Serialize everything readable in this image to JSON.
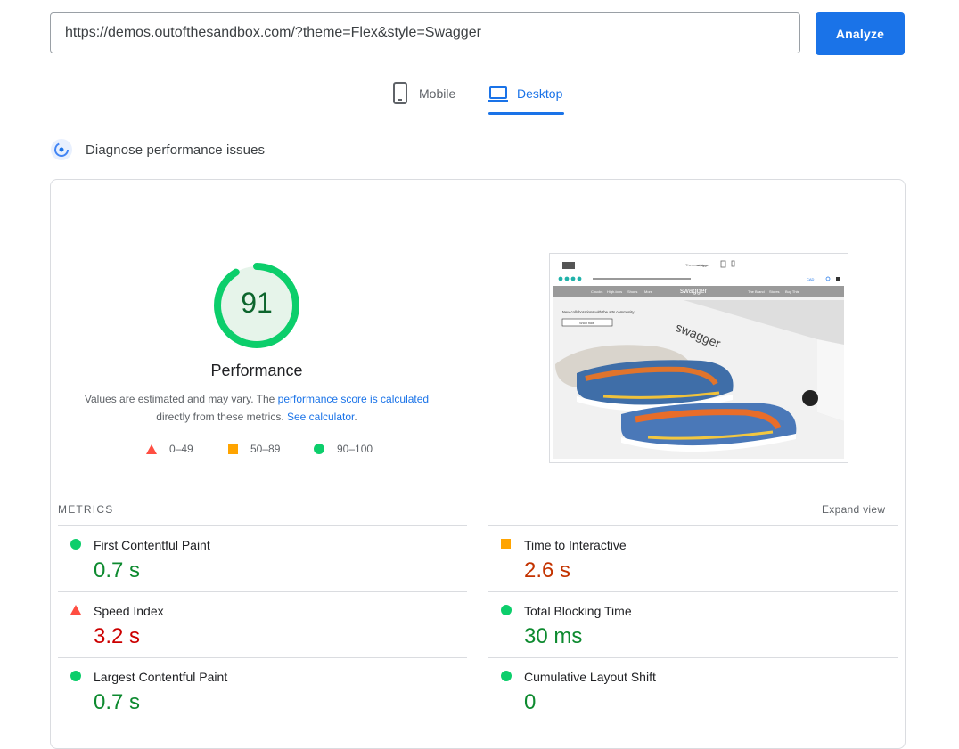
{
  "search": {
    "url": "https://demos.outofthesandbox.com/?theme=Flex&style=Swagger",
    "button_label": "Analyze"
  },
  "tabs": [
    {
      "label": "Mobile"
    },
    {
      "label": "Desktop"
    }
  ],
  "diagnose": {
    "label": "Diagnose performance issues"
  },
  "performance": {
    "score": "91",
    "score_fraction": 0.91,
    "title": "Performance",
    "note_prefix": "Values are estimated and may vary. The ",
    "note_link1": "performance score is calculated",
    "note_mid": "directly from these metrics. ",
    "note_link2": "See calculator",
    "note_suffix": "."
  },
  "legend": [
    {
      "range": "0–49",
      "icon": "triangle-icon",
      "color": "#ff4e42"
    },
    {
      "range": "50–89",
      "icon": "square-icon",
      "color": "#ffa400"
    },
    {
      "range": "90–100",
      "icon": "circle-icon",
      "color": "#0cce6b"
    }
  ],
  "screenshot": {
    "brand": "swagger",
    "hero_text": "New collaborations with the arts community",
    "hero_button": "Shop now",
    "nav_left": [
      "Chucks",
      "High-tops",
      "Shoes",
      "More"
    ],
    "nav_right": [
      "The Brand",
      "Stores",
      "Buy This"
    ],
    "theme_label": "Theme styles",
    "theme_value": "swagger",
    "currency": "CAD"
  },
  "metrics": {
    "heading": "METRICS",
    "expand_label": "Expand view",
    "items": [
      {
        "name": "First Contentful Paint",
        "value": "0.7 s",
        "rating": "green"
      },
      {
        "name": "Time to Interactive",
        "value": "2.6 s",
        "rating": "orange"
      },
      {
        "name": "Speed Index",
        "value": "3.2 s",
        "rating": "red"
      },
      {
        "name": "Total Blocking Time",
        "value": "30 ms",
        "rating": "green"
      },
      {
        "name": "Largest Contentful Paint",
        "value": "0.7 s",
        "rating": "green"
      },
      {
        "name": "Cumulative Layout Shift",
        "value": "0",
        "rating": "green"
      }
    ]
  },
  "colors": {
    "accent": "#1a73e8",
    "good": "#0cce6b",
    "average": "#ffa400",
    "poor": "#ff4e42"
  }
}
